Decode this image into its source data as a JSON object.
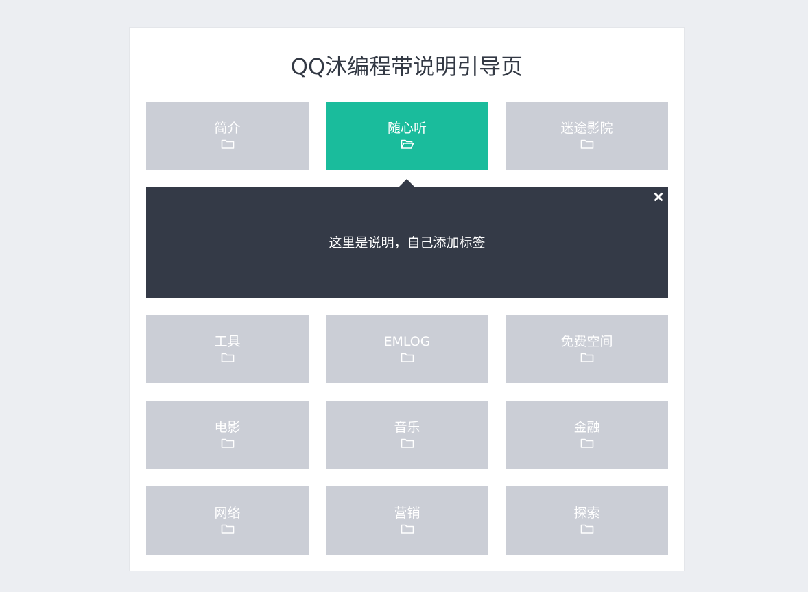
{
  "page": {
    "title": "QQ沐编程带说明引导页"
  },
  "tiles_top": [
    {
      "label": "简介",
      "icon": "folder-icon",
      "active": false
    },
    {
      "label": "随心听",
      "icon": "folder-open-icon",
      "active": true
    },
    {
      "label": "迷途影院",
      "icon": "folder-icon",
      "active": false
    }
  ],
  "panel": {
    "text": "这里是说明，自己添加标签",
    "close_icon": "close-icon"
  },
  "tiles_bottom": [
    {
      "label": "工具",
      "icon": "folder-icon"
    },
    {
      "label": "EMLOG",
      "icon": "folder-icon"
    },
    {
      "label": "免费空间",
      "icon": "folder-icon"
    },
    {
      "label": "电影",
      "icon": "folder-icon"
    },
    {
      "label": "音乐",
      "icon": "folder-icon"
    },
    {
      "label": "金融",
      "icon": "folder-icon"
    },
    {
      "label": "网络",
      "icon": "folder-icon"
    },
    {
      "label": "营销",
      "icon": "folder-icon"
    },
    {
      "label": "探索",
      "icon": "folder-icon"
    }
  ],
  "colors": {
    "background": "#eceef2",
    "tile": "#cbced6",
    "tile_active": "#1abc9c",
    "panel": "#343a47",
    "title_text": "#333944"
  }
}
